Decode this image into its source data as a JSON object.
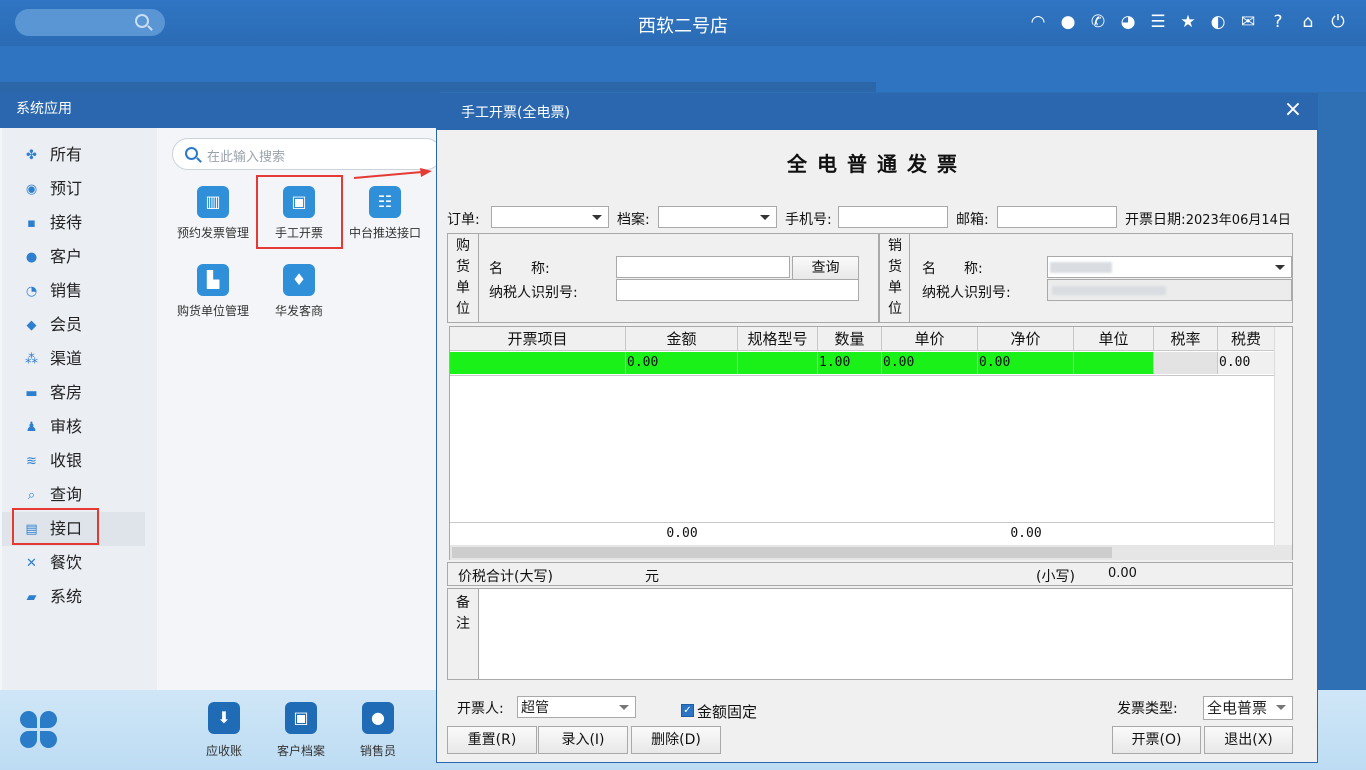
{
  "topbar": {
    "title": "西软二号店",
    "icons": [
      "wifi-icon",
      "chat-icon",
      "phone-icon",
      "palette-icon",
      "menu-icon",
      "star-icon",
      "theme-icon",
      "mail-icon",
      "help-icon",
      "home-icon",
      "power-icon"
    ]
  },
  "sysapp": {
    "title": "系统应用",
    "sidebar": [
      {
        "label": "所有",
        "icon": "grid-icon"
      },
      {
        "label": "预订",
        "icon": "user-circle-icon"
      },
      {
        "label": "接待",
        "icon": "chat-bubble-icon"
      },
      {
        "label": "客户",
        "icon": "person-icon"
      },
      {
        "label": "销售",
        "icon": "pie-icon"
      },
      {
        "label": "会员",
        "icon": "diamond-icon"
      },
      {
        "label": "渠道",
        "icon": "network-icon"
      },
      {
        "label": "客房",
        "icon": "bed-icon"
      },
      {
        "label": "审核",
        "icon": "stamp-icon"
      },
      {
        "label": "收银",
        "icon": "coins-icon"
      },
      {
        "label": "查询",
        "icon": "search-icon"
      },
      {
        "label": "接口",
        "icon": "interface-icon"
      },
      {
        "label": "餐饮",
        "icon": "dining-icon"
      },
      {
        "label": "系统",
        "icon": "system-icon"
      }
    ],
    "selected": "接口",
    "search_placeholder": "在此输入搜索",
    "apps": [
      {
        "label": "预约发票管理",
        "icon": "invoice-icon"
      },
      {
        "label": "手工开票",
        "icon": "manual-invoice-icon"
      },
      {
        "label": "中台推送接口",
        "icon": "sliders-icon"
      },
      {
        "label": "购货单位管理",
        "icon": "building-icon"
      },
      {
        "label": "华发客商",
        "icon": "tie-icon"
      }
    ]
  },
  "dock": {
    "apps": [
      {
        "label": "应收账",
        "icon": "download-icon"
      },
      {
        "label": "客户档案",
        "icon": "profile-card-icon"
      },
      {
        "label": "销售员",
        "icon": "salesperson-icon"
      }
    ]
  },
  "dialog": {
    "title": "手工开票(全电票)",
    "heading": "全电普通发票",
    "order_label": "订单:",
    "order_value": "",
    "archive_label": "档案:",
    "archive_value": "",
    "phone_label": "手机号:",
    "phone_value": "",
    "email_label": "邮箱:",
    "email_value": "",
    "date_label": "开票日期:",
    "date_value": "2023年06月14日",
    "buyer": {
      "section": [
        "购",
        "货",
        "单",
        "位"
      ],
      "name_label": "名　　称:",
      "name_value": "",
      "query_button": "查询",
      "taxid_label": "纳税人识别号:",
      "taxid_value": ""
    },
    "seller": {
      "section": [
        "销",
        "货",
        "单",
        "位"
      ],
      "name_label": "名　　称:",
      "taxid_label": "纳税人识别号:"
    },
    "table": {
      "columns": [
        "开票项目",
        "金额",
        "规格型号",
        "数量",
        "单价",
        "净价",
        "单位",
        "税率",
        "税费"
      ],
      "rows": [
        {
          "item": "",
          "amount": "0.00",
          "spec": "",
          "qty": "1.00",
          "price": "0.00",
          "net": "0.00",
          "unit": "",
          "rate": "",
          "tax": "0.00"
        }
      ],
      "totals": {
        "amount": "0.00",
        "net": "0.00"
      }
    },
    "total_label_upper": "价税合计(大写)",
    "total_upper_value": "元",
    "total_label_lower": "(小写)",
    "total_lower_value": "0.00",
    "remark_label": [
      "备",
      "注"
    ],
    "remark_value": "",
    "issuer_label": "开票人:",
    "issuer_value": "超管",
    "fixed_amount_label": "金额固定",
    "fixed_amount_checked": true,
    "invoice_type_label": "发票类型:",
    "invoice_type_value": "全电普票",
    "buttons": {
      "reset": "重置(R)",
      "enter": "录入(I)",
      "delete": "删除(D)",
      "issue": "开票(O)",
      "exit": "退出(X)"
    }
  }
}
